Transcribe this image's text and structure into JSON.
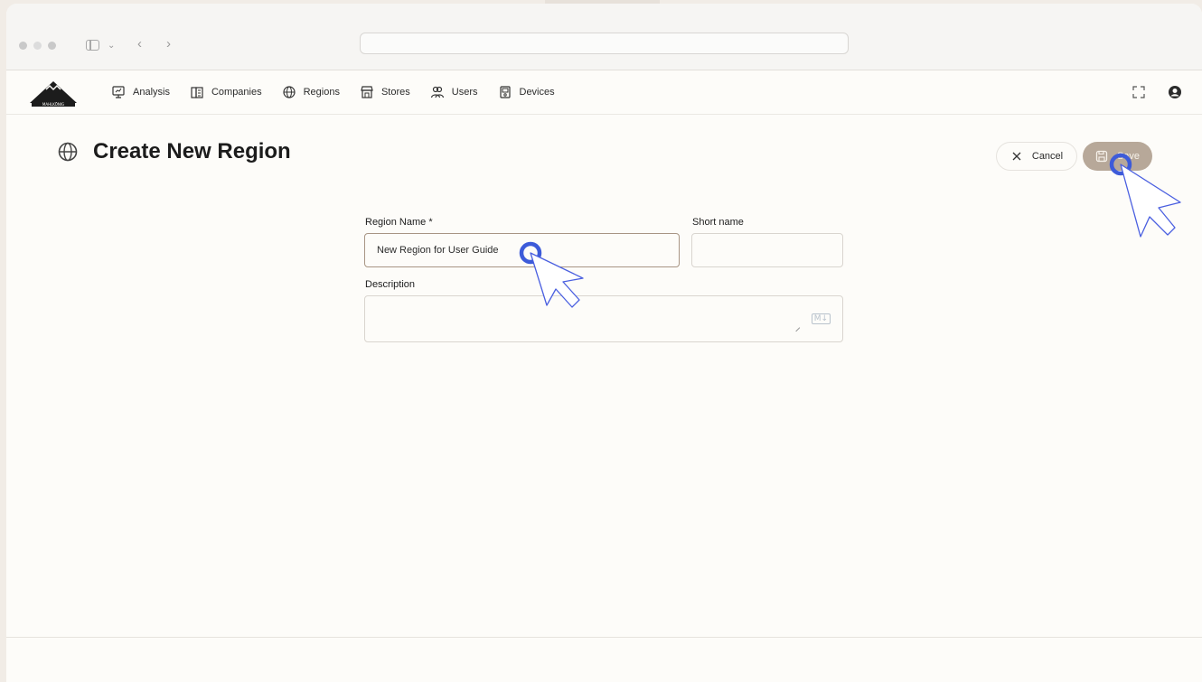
{
  "nav": {
    "logo_text": "MAHLKÖNIG",
    "items": [
      {
        "label": "Analysis",
        "icon": "presentation-chart-icon"
      },
      {
        "label": "Companies",
        "icon": "building-icon"
      },
      {
        "label": "Regions",
        "icon": "globe-icon"
      },
      {
        "label": "Stores",
        "icon": "store-icon"
      },
      {
        "label": "Users",
        "icon": "users-icon"
      },
      {
        "label": "Devices",
        "icon": "device-icon"
      }
    ]
  },
  "page": {
    "title": "Create New Region",
    "cancel_label": "Cancel",
    "save_label": "Save"
  },
  "form": {
    "region_name_label": "Region Name *",
    "region_name_value": "New Region for User Guide",
    "short_name_label": "Short name",
    "short_name_value": "",
    "description_label": "Description",
    "description_value": "",
    "markdown_badge": "M↓"
  },
  "colors": {
    "accent": "#b7a899",
    "cursor": "#3d5bd9"
  }
}
